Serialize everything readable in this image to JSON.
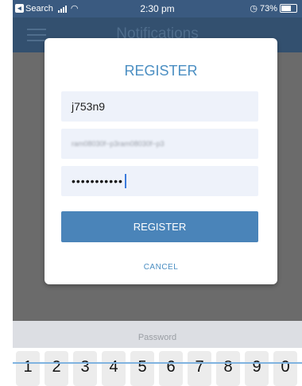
{
  "status_bar": {
    "back_app": "Search",
    "time": "2:30 pm",
    "battery_text": "73%",
    "battery_level": 0.73,
    "alarm_icon": "alarm-icon"
  },
  "nav": {
    "title": "Notifications",
    "menu_icon": "hamburger-icon"
  },
  "modal": {
    "title": "REGISTER",
    "username_value": "j753n9",
    "email_value": "ram08030f~p3ram08030f~p3",
    "password_value": "•••••••••••",
    "register_label": "REGISTER",
    "cancel_label": "CANCEL"
  },
  "keyboard": {
    "field_label": "Password",
    "keys": [
      "1",
      "2",
      "3",
      "4",
      "5",
      "6",
      "7",
      "8",
      "9",
      "0"
    ]
  },
  "colors": {
    "accent": "#4a8ec2",
    "button": "#4a84b9",
    "status_bar": "#3a5a80",
    "nav_bar": "#33506f"
  }
}
